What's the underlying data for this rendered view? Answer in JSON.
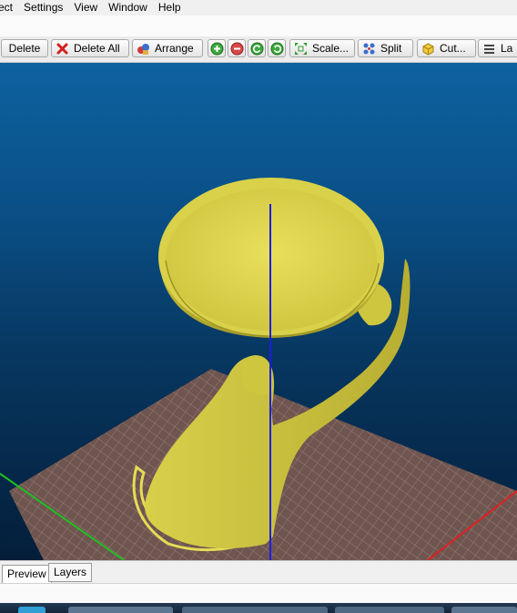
{
  "menu": [
    "ect",
    "Settings",
    "View",
    "Window",
    "Help"
  ],
  "toolbar": {
    "delete_label": "Delete",
    "delete_all_label": "Delete All",
    "arrange_label": "Arrange",
    "scale_label": "Scale...",
    "split_label": "Split",
    "cut_label": "Cut...",
    "layers_label": "La"
  },
  "icons": {
    "delete_all": "red-x-icon",
    "arrange": "arrange-icon",
    "add_copy": "plus-circle-icon",
    "remove_copy": "minus-circle-icon",
    "rotate_left": "rotate-left-icon",
    "rotate_right": "rotate-right-icon",
    "scale": "scale-arrows-icon",
    "split": "split-icon",
    "cut": "cut-icon",
    "layers": "layers-icon"
  },
  "colors": {
    "model": "#d9d14a",
    "bed": "#6f5550",
    "bed_grid": "#a98880",
    "z_axis": "#1d1de0",
    "x_axis": "#e02020",
    "y_axis": "#20c020"
  },
  "tabs": {
    "preview": "Preview",
    "layers": "Layers"
  }
}
